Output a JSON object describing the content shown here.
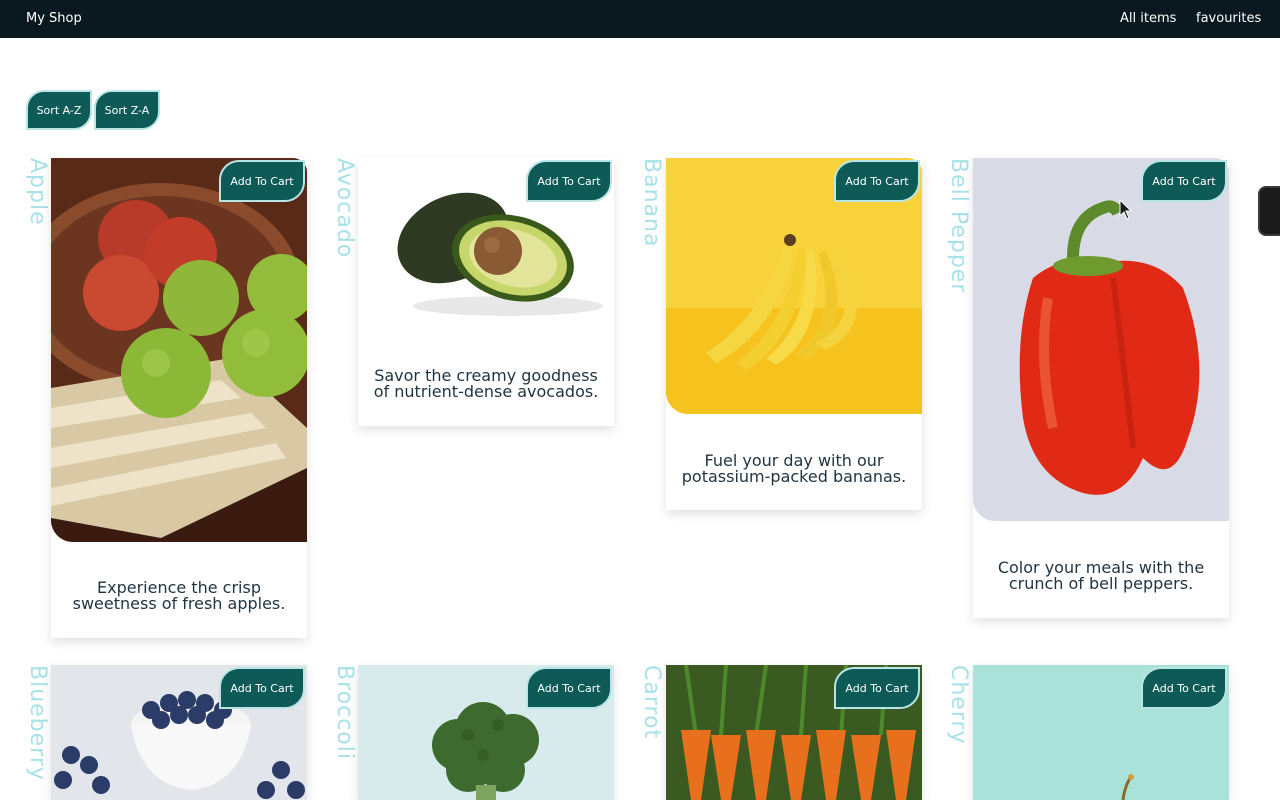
{
  "header": {
    "brand": "My Shop",
    "nav": [
      "All items",
      "favourites"
    ]
  },
  "sort": {
    "az_label": "Sort A-Z",
    "za_label": "Sort Z-A"
  },
  "cart_label": "Add To Cart",
  "products": [
    {
      "name": "Apple",
      "description": "Experience the crisp sweetness of fresh apples."
    },
    {
      "name": "Avocado",
      "description": "Savor the creamy goodness of nutrient-dense avocados."
    },
    {
      "name": "Banana",
      "description": "Fuel your day with our potassium-packed bananas."
    },
    {
      "name": "Bell Pepper",
      "description": "Color your meals with the crunch of bell peppers."
    },
    {
      "name": "Blueberry",
      "description": ""
    },
    {
      "name": "Broccoli",
      "description": ""
    },
    {
      "name": "Carrot",
      "description": ""
    },
    {
      "name": "Cherry",
      "description": ""
    }
  ],
  "colors": {
    "topbar": "#0a1820",
    "accent": "#0d5a57",
    "accent_border": "#b9e6e4",
    "side_label": "#a8e2e8"
  },
  "icons": [
    "mouse-pointer-icon",
    "scroll-handle"
  ]
}
